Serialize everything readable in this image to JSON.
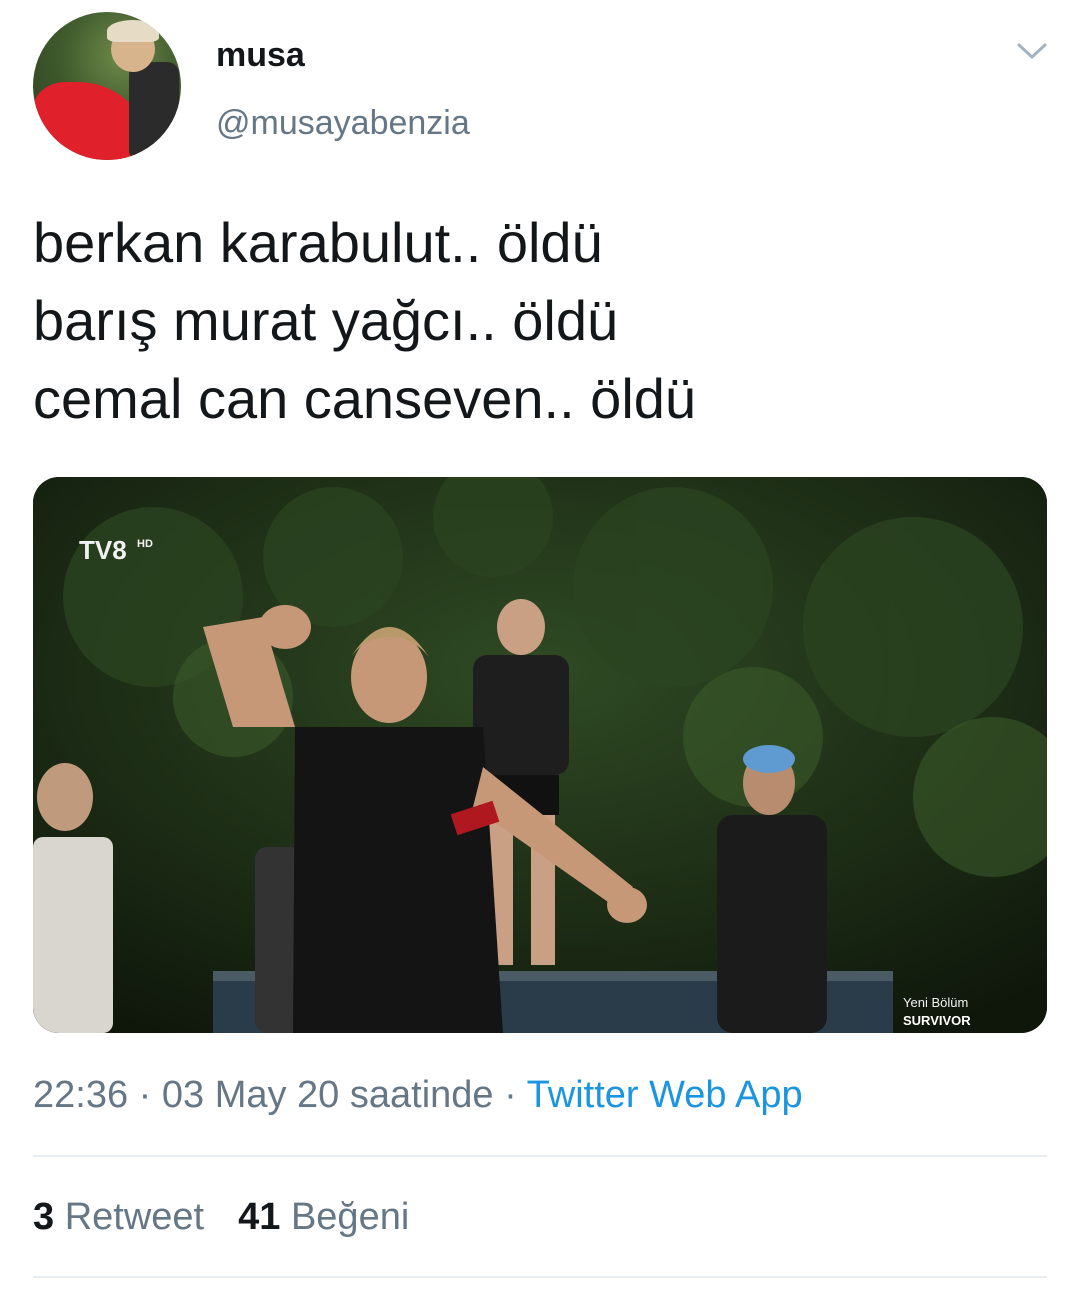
{
  "author": {
    "display_name": "musa",
    "handle": "@musayabenzia"
  },
  "tweet": {
    "lines": [
      "berkan karabulut.. öldü",
      "barış murat yağcı.. öldü",
      "cemal can canseven.. öldü"
    ]
  },
  "media": {
    "logo_text": "TV8",
    "logo_badge": "HD",
    "caption_top": "Yeni Bölüm",
    "caption_bottom": "SURVIVOR"
  },
  "meta": {
    "time": "22:36",
    "separator": " · ",
    "date": "03 May 20 saatinde",
    "separator2": " · ",
    "source": "Twitter Web App"
  },
  "stats": {
    "retweet_count": "3",
    "retweet_label": "Retweet",
    "like_count": "41",
    "like_label": "Beğeni"
  },
  "colors": {
    "link": "#1b95e0",
    "secondary_text": "#657786",
    "primary_text": "#14171a",
    "divider": "#e6ecf0"
  },
  "icons": {
    "more": "chevron-down-icon"
  }
}
